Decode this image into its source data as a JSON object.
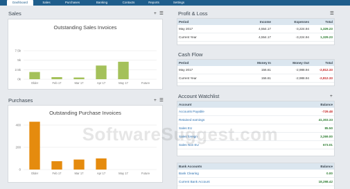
{
  "nav": {
    "items": [
      "Dashboard",
      "Sales",
      "Purchases",
      "Banking",
      "Contacts",
      "Reports",
      "Settings"
    ],
    "active": "Dashboard"
  },
  "sales": {
    "section_title": "Sales",
    "chart_title": "Outstanding Sales Invoices",
    "icons": [
      "plus-icon",
      "menu-icon"
    ]
  },
  "purchases": {
    "section_title": "Purchases",
    "chart_title": "Outstanding Purchase Invoices",
    "icons": [
      "plus-icon",
      "menu-icon"
    ]
  },
  "chart_data": [
    {
      "type": "bar",
      "title": "Outstanding Sales Invoices",
      "categories": [
        "Older",
        "Feb 17",
        "Mar 17",
        "Apr 17",
        "May 17",
        "Future"
      ],
      "values": [
        1900,
        550,
        450,
        3600,
        4600,
        0
      ],
      "ylim": [
        0,
        7500
      ],
      "ytick_labels": [
        "0k",
        "2.5k",
        "5k",
        "7.5k"
      ],
      "color": "#a4c15a"
    },
    {
      "type": "bar",
      "title": "Outstanding Purchase Invoices",
      "categories": [
        "Older",
        "Feb 17",
        "Mar 17",
        "Apr 17",
        "May 17",
        "Future"
      ],
      "values": [
        430,
        75,
        90,
        100,
        0,
        0
      ],
      "ylim": [
        0,
        400
      ],
      "ytick_labels": [
        "0",
        "200",
        "400"
      ],
      "color": "#e58b0e"
    }
  ],
  "profit_loss": {
    "title": "Profit & Loss",
    "icon": "menu-icon",
    "headers": [
      "Period",
      "Income",
      "Expenses",
      "Total"
    ],
    "rows": [
      [
        "May 2017",
        "4,554.17",
        "-3,224.94",
        "1,329.23"
      ],
      [
        "Current Year",
        "4,554.17",
        "-3,224.94",
        "1,329.23"
      ]
    ]
  },
  "cash_flow": {
    "title": "Cash Flow",
    "headers": [
      "Period",
      "Money In",
      "Money Out",
      "Total"
    ],
    "rows": [
      [
        "May 2017",
        "156.61",
        "-2,988.94",
        "-2,812.33"
      ],
      [
        "Current Year",
        "156.61",
        "-2,988.94",
        "-2,812.33"
      ]
    ]
  },
  "watchlist": {
    "title": "Account Watchlist",
    "icon": "plus-icon",
    "headers": [
      "Account",
      "Balance"
    ],
    "rows": [
      [
        "Accounts Payable",
        "-729.48"
      ],
      [
        "Retained earnings",
        "41,303.33"
      ],
      [
        "Sales EU",
        "85.50"
      ],
      [
        "Sales foreign",
        "3,269.00"
      ],
      [
        "Sales Non EU",
        "673.01"
      ]
    ]
  },
  "bank_accounts": {
    "headers": [
      "Bank Accounts",
      "Balance"
    ],
    "rows": [
      [
        "Bank Clearing",
        "0.00"
      ],
      [
        "Current Bank Account",
        "18,298.42"
      ]
    ]
  },
  "watermark": "SoftwareSuggest.com"
}
